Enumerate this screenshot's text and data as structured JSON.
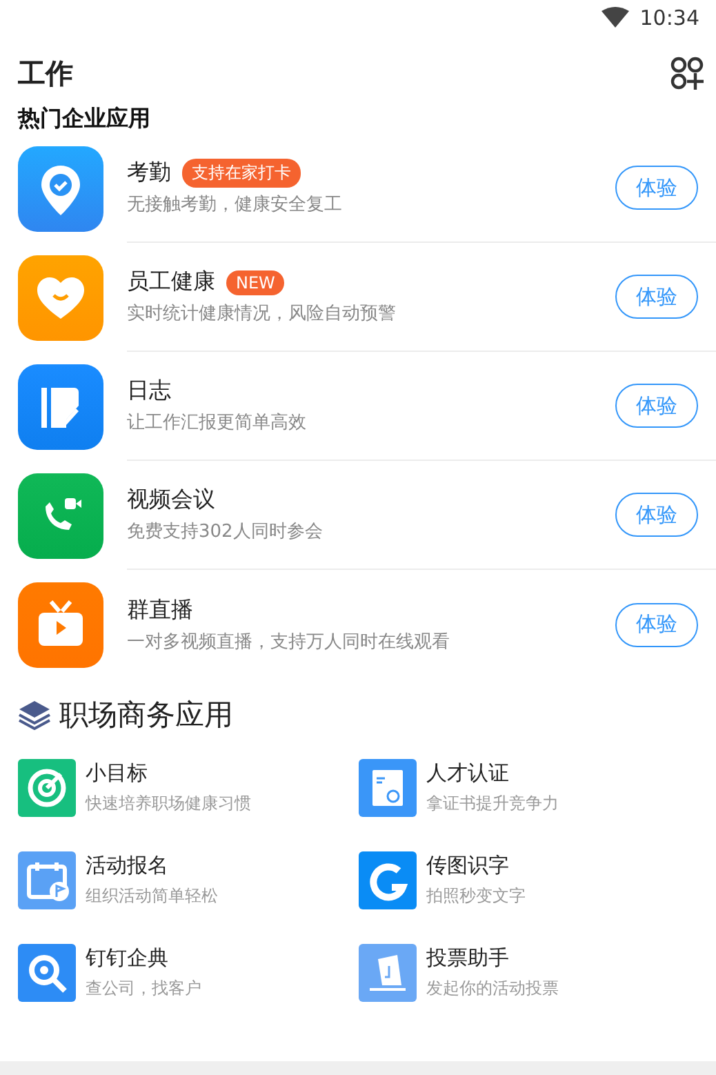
{
  "status_bar": {
    "time": "10:34"
  },
  "header": {
    "title": "工作"
  },
  "hot_section": {
    "title": "热门企业应用",
    "apps": [
      {
        "kind": "attendance",
        "name": "考勤",
        "badge": "支持在家打卡",
        "description": "无接触考勤，健康安全复工",
        "button": "体验"
      },
      {
        "kind": "health",
        "name": "员工健康",
        "badge": "NEW",
        "description": "实时统计健康情况，风险自动预警",
        "button": "体验"
      },
      {
        "kind": "log",
        "name": "日志",
        "description": "让工作汇报更简单高效",
        "button": "体验"
      },
      {
        "kind": "video",
        "name": "视频会议",
        "description": "免费支持302人同时参会",
        "button": "体验"
      },
      {
        "kind": "live",
        "name": "群直播",
        "description": "一对多视频直播，支持万人同时在线观看",
        "button": "体验"
      }
    ]
  },
  "business_section": {
    "title": "职场商务应用",
    "apps": [
      {
        "kind": "target",
        "name": "小目标",
        "description": "快速培养职场健康习惯"
      },
      {
        "kind": "certificate",
        "name": "人才认证",
        "description": "拿证书提升竞争力"
      },
      {
        "kind": "event",
        "name": "活动报名",
        "description": "组织活动简单轻松"
      },
      {
        "kind": "ocr",
        "name": "传图识字",
        "description": "拍照秒变文字"
      },
      {
        "kind": "search",
        "name": "钉钉企典",
        "description": "查公司，找客户"
      },
      {
        "kind": "vote",
        "name": "投票助手",
        "description": "发起你的活动投票"
      }
    ]
  }
}
